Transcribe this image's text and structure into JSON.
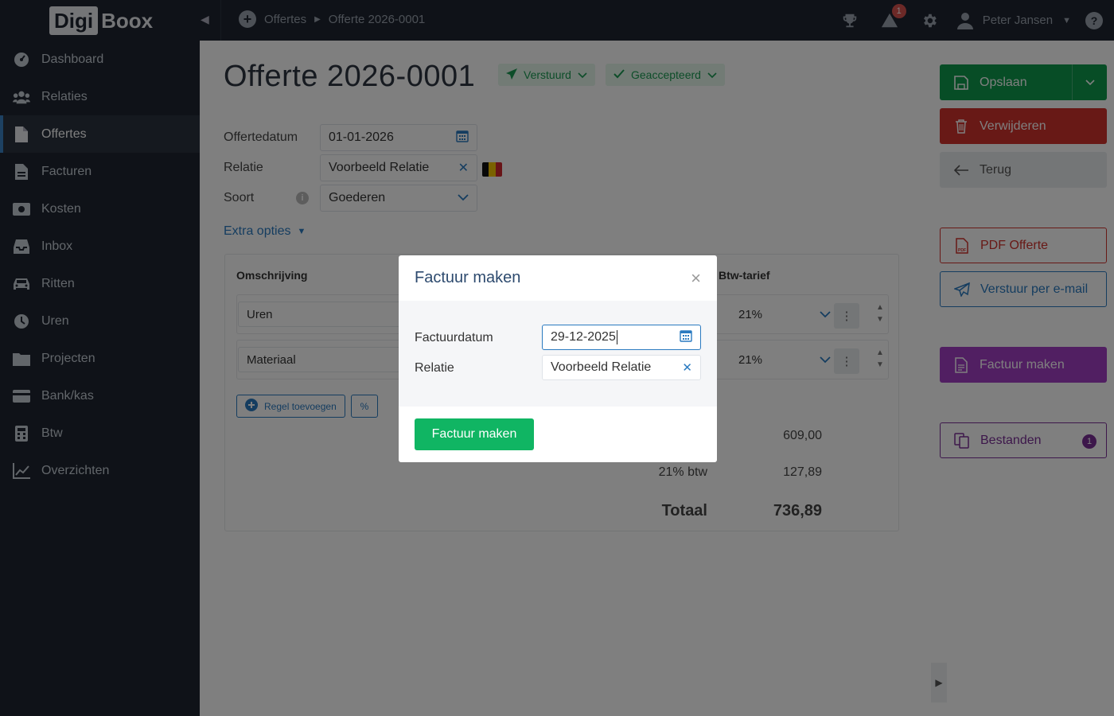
{
  "app": {
    "logo_part1": "Digi",
    "logo_part2": "Boox"
  },
  "breadcrumb": {
    "items": [
      "Offertes",
      "Offerte 2026-0001"
    ]
  },
  "topbar": {
    "notification_count": "1",
    "user_name": "Peter Jansen",
    "help_glyph": "?"
  },
  "sidebar": {
    "items": [
      {
        "label": "Dashboard",
        "icon": "dashboard-icon",
        "active": false
      },
      {
        "label": "Relaties",
        "icon": "users-icon",
        "active": false
      },
      {
        "label": "Offertes",
        "icon": "file-icon",
        "active": true
      },
      {
        "label": "Facturen",
        "icon": "invoice-icon",
        "active": false
      },
      {
        "label": "Kosten",
        "icon": "money-icon",
        "active": false
      },
      {
        "label": "Inbox",
        "icon": "inbox-icon",
        "active": false
      },
      {
        "label": "Ritten",
        "icon": "car-icon",
        "active": false
      },
      {
        "label": "Uren",
        "icon": "clock-icon",
        "active": false
      },
      {
        "label": "Projecten",
        "icon": "folder-icon",
        "active": false
      },
      {
        "label": "Bank/kas",
        "icon": "card-icon",
        "active": false
      },
      {
        "label": "Btw",
        "icon": "calculator-icon",
        "active": false
      },
      {
        "label": "Overzichten",
        "icon": "chart-icon",
        "active": false
      }
    ]
  },
  "page": {
    "title": "Offerte 2026-0001",
    "status_sent": "Verstuurd",
    "status_accepted": "Geaccepteerd"
  },
  "form": {
    "date_label": "Offertedatum",
    "date_value": "01-01-2026",
    "relation_label": "Relatie",
    "relation_value": "Voorbeeld Relatie",
    "type_label": "Soort",
    "type_value": "Goederen",
    "info_glyph": "i",
    "extra_options": "Extra opties"
  },
  "lines": {
    "col_description": "Omschrijving",
    "col_vat": "Btw-tarief",
    "rows": [
      {
        "description": "Uren",
        "vat": "21%"
      },
      {
        "description": "Materiaal",
        "vat": "21%"
      }
    ],
    "add_line": "Regel toevoegen",
    "percent_glyph": "%"
  },
  "totals": {
    "subtotal": "609,00",
    "vat_label": "21% btw",
    "vat_amount": "127,89",
    "total_label": "Totaal",
    "total_amount": "736,89"
  },
  "actions": {
    "save": "Opslaan",
    "delete": "Verwijderen",
    "back": "Terug",
    "pdf": "PDF Offerte",
    "email": "Verstuur per e-mail",
    "make_invoice": "Factuur maken",
    "files": "Bestanden",
    "files_count": "1"
  },
  "modal": {
    "title": "Factuur maken",
    "close_glyph": "×",
    "date_label": "Factuurdatum",
    "date_value": "29-12-2025",
    "relation_label": "Relatie",
    "relation_value": "Voorbeeld Relatie",
    "submit": "Factuur maken"
  },
  "colors": {
    "sidebar_bg": "#1e2530",
    "save_green": "#0f9a4d",
    "delete_red": "#d0322d",
    "invoice_purple": "#a23fc4",
    "link_blue": "#2a7ac0",
    "modal_submit_green": "#10b563"
  }
}
